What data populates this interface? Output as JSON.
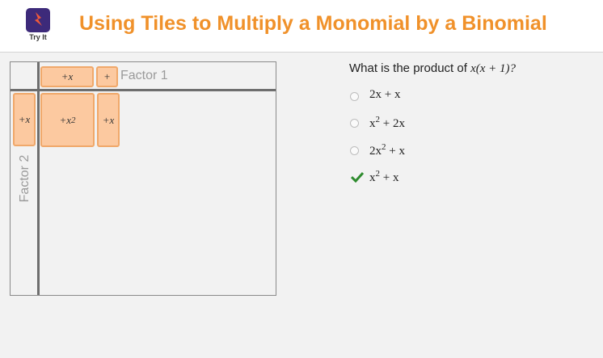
{
  "header": {
    "logo_icon": "lightning-bolt-icon",
    "logo_label": "Try It",
    "title": "Using Tiles to Multiply a Monomial by a Binomial"
  },
  "grid": {
    "factor1_label": "Factor 1",
    "factor2_label": "Factor 2",
    "factor1_tiles": [
      "+x",
      "+"
    ],
    "factor2_tiles": [
      "+x"
    ],
    "product_tiles": [
      {
        "base": "+x",
        "exp": "2"
      },
      {
        "base": "+x",
        "exp": ""
      }
    ]
  },
  "question": {
    "prefix": "What is the product of ",
    "expr_x": "x",
    "expr_rest": "(x + 1)?"
  },
  "options": [
    {
      "a": "2x",
      "exp": "",
      "b": " + x",
      "selected": false
    },
    {
      "a": "x",
      "exp": "2",
      "b": " + 2x",
      "selected": false
    },
    {
      "a": "2x",
      "exp": "2",
      "b": " + x",
      "selected": false
    },
    {
      "a": "x",
      "exp": "2",
      "b": " + x",
      "selected": true
    }
  ],
  "colors": {
    "title": "#f0912a",
    "tile_fill": "#fcc9a0",
    "tile_border": "#f0a86a",
    "logo_bg": "#3d2a7a",
    "check": "#2e8b2e"
  }
}
